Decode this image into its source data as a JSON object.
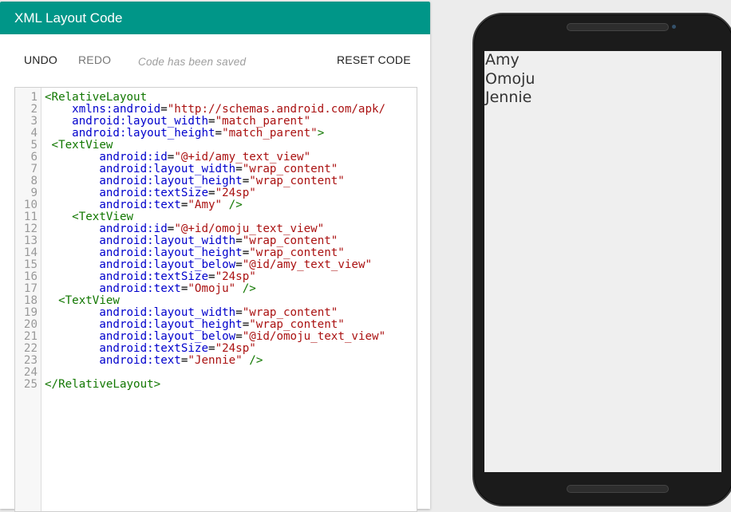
{
  "panel": {
    "title": "XML Layout Code",
    "toolbar": {
      "undo": "UNDO",
      "redo": "REDO",
      "status": "Code has been saved",
      "reset": "RESET CODE"
    }
  },
  "editor": {
    "lines": [
      {
        "n": "1",
        "tokens": [
          {
            "c": "tag",
            "t": "<RelativeLayout"
          }
        ]
      },
      {
        "n": "2",
        "tokens": [
          {
            "c": "plain",
            "t": "    "
          },
          {
            "c": "attr",
            "t": "xmlns:android"
          },
          {
            "c": "plain",
            "t": "="
          },
          {
            "c": "str",
            "t": "\"http://schemas.android.com/apk/"
          }
        ]
      },
      {
        "n": "3",
        "tokens": [
          {
            "c": "plain",
            "t": "    "
          },
          {
            "c": "attr",
            "t": "android:layout_width"
          },
          {
            "c": "plain",
            "t": "="
          },
          {
            "c": "str",
            "t": "\"match_parent\""
          }
        ]
      },
      {
        "n": "4",
        "tokens": [
          {
            "c": "plain",
            "t": "    "
          },
          {
            "c": "attr",
            "t": "android:layout_height"
          },
          {
            "c": "plain",
            "t": "="
          },
          {
            "c": "str",
            "t": "\"match_parent\""
          },
          {
            "c": "tag",
            "t": ">"
          }
        ]
      },
      {
        "n": "5",
        "tokens": [
          {
            "c": "plain",
            "t": " "
          },
          {
            "c": "tag",
            "t": "<TextView"
          }
        ]
      },
      {
        "n": "6",
        "tokens": [
          {
            "c": "plain",
            "t": "        "
          },
          {
            "c": "attr",
            "t": "android:id"
          },
          {
            "c": "plain",
            "t": "="
          },
          {
            "c": "str",
            "t": "\"@+id/amy_text_view\""
          }
        ]
      },
      {
        "n": "7",
        "tokens": [
          {
            "c": "plain",
            "t": "        "
          },
          {
            "c": "attr",
            "t": "android:layout_width"
          },
          {
            "c": "plain",
            "t": "="
          },
          {
            "c": "str",
            "t": "\"wrap_content\""
          }
        ]
      },
      {
        "n": "8",
        "tokens": [
          {
            "c": "plain",
            "t": "        "
          },
          {
            "c": "attr",
            "t": "android:layout_height"
          },
          {
            "c": "plain",
            "t": "="
          },
          {
            "c": "str",
            "t": "\"wrap_content\""
          }
        ]
      },
      {
        "n": "9",
        "tokens": [
          {
            "c": "plain",
            "t": "        "
          },
          {
            "c": "attr",
            "t": "android:textSize"
          },
          {
            "c": "plain",
            "t": "="
          },
          {
            "c": "str",
            "t": "\"24sp\""
          }
        ]
      },
      {
        "n": "10",
        "tokens": [
          {
            "c": "plain",
            "t": "        "
          },
          {
            "c": "attr",
            "t": "android:text"
          },
          {
            "c": "plain",
            "t": "="
          },
          {
            "c": "str",
            "t": "\"Amy\""
          },
          {
            "c": "plain",
            "t": " "
          },
          {
            "c": "tag",
            "t": "/>"
          }
        ]
      },
      {
        "n": "11",
        "tokens": [
          {
            "c": "plain",
            "t": "    "
          },
          {
            "c": "tag",
            "t": "<TextView"
          }
        ]
      },
      {
        "n": "12",
        "tokens": [
          {
            "c": "plain",
            "t": "        "
          },
          {
            "c": "attr",
            "t": "android:id"
          },
          {
            "c": "plain",
            "t": "="
          },
          {
            "c": "str",
            "t": "\"@+id/omoju_text_view\""
          }
        ]
      },
      {
        "n": "13",
        "tokens": [
          {
            "c": "plain",
            "t": "        "
          },
          {
            "c": "attr",
            "t": "android:layout_width"
          },
          {
            "c": "plain",
            "t": "="
          },
          {
            "c": "str",
            "t": "\"wrap_content\""
          }
        ]
      },
      {
        "n": "14",
        "tokens": [
          {
            "c": "plain",
            "t": "        "
          },
          {
            "c": "attr",
            "t": "android:layout_height"
          },
          {
            "c": "plain",
            "t": "="
          },
          {
            "c": "str",
            "t": "\"wrap_content\""
          }
        ]
      },
      {
        "n": "15",
        "tokens": [
          {
            "c": "plain",
            "t": "        "
          },
          {
            "c": "attr",
            "t": "android:layout_below"
          },
          {
            "c": "plain",
            "t": "="
          },
          {
            "c": "str",
            "t": "\"@id/amy_text_view\""
          }
        ]
      },
      {
        "n": "16",
        "tokens": [
          {
            "c": "plain",
            "t": "        "
          },
          {
            "c": "attr",
            "t": "android:textSize"
          },
          {
            "c": "plain",
            "t": "="
          },
          {
            "c": "str",
            "t": "\"24sp\""
          }
        ]
      },
      {
        "n": "17",
        "tokens": [
          {
            "c": "plain",
            "t": "        "
          },
          {
            "c": "attr",
            "t": "android:text"
          },
          {
            "c": "plain",
            "t": "="
          },
          {
            "c": "str",
            "t": "\"Omoju\""
          },
          {
            "c": "plain",
            "t": " "
          },
          {
            "c": "tag",
            "t": "/>"
          }
        ]
      },
      {
        "n": "18",
        "tokens": [
          {
            "c": "plain",
            "t": "  "
          },
          {
            "c": "tag",
            "t": "<TextView"
          }
        ]
      },
      {
        "n": "19",
        "tokens": [
          {
            "c": "plain",
            "t": "        "
          },
          {
            "c": "attr",
            "t": "android:layout_width"
          },
          {
            "c": "plain",
            "t": "="
          },
          {
            "c": "str",
            "t": "\"wrap_content\""
          }
        ]
      },
      {
        "n": "20",
        "tokens": [
          {
            "c": "plain",
            "t": "        "
          },
          {
            "c": "attr",
            "t": "android:layout_height"
          },
          {
            "c": "plain",
            "t": "="
          },
          {
            "c": "str",
            "t": "\"wrap_content\""
          }
        ]
      },
      {
        "n": "21",
        "tokens": [
          {
            "c": "plain",
            "t": "        "
          },
          {
            "c": "attr",
            "t": "android:layout_below"
          },
          {
            "c": "plain",
            "t": "="
          },
          {
            "c": "str",
            "t": "\"@id/omoju_text_view\""
          }
        ]
      },
      {
        "n": "22",
        "tokens": [
          {
            "c": "plain",
            "t": "        "
          },
          {
            "c": "attr",
            "t": "android:textSize"
          },
          {
            "c": "plain",
            "t": "="
          },
          {
            "c": "str",
            "t": "\"24sp\""
          }
        ]
      },
      {
        "n": "23",
        "tokens": [
          {
            "c": "plain",
            "t": "        "
          },
          {
            "c": "attr",
            "t": "android:text"
          },
          {
            "c": "plain",
            "t": "="
          },
          {
            "c": "str",
            "t": "\"Jennie\""
          },
          {
            "c": "plain",
            "t": " "
          },
          {
            "c": "tag",
            "t": "/>"
          }
        ]
      },
      {
        "n": "24",
        "tokens": []
      },
      {
        "n": "25",
        "tokens": [
          {
            "c": "tag",
            "t": "</RelativeLayout>"
          }
        ]
      }
    ]
  },
  "phone": {
    "screen": {
      "text_views": [
        "Amy",
        "Omoju",
        "Jennie"
      ]
    }
  }
}
